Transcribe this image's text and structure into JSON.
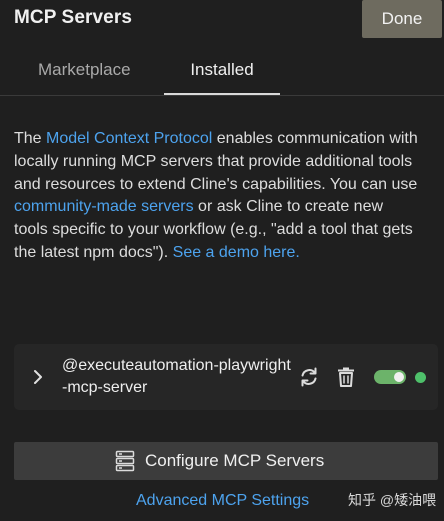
{
  "header": {
    "title": "MCP Servers",
    "done_label": "Done"
  },
  "tabs": [
    {
      "label": "Marketplace",
      "active": false
    },
    {
      "label": "Installed",
      "active": true
    }
  ],
  "description": {
    "part1": "The ",
    "link_protocol": "Model Context Protocol",
    "part2": " enables communication with locally running MCP servers that provide additional tools and resources to extend Cline's capabilities. You can use ",
    "link_community": "community-made servers",
    "part3": " or ask Cline to create new tools specific to your workflow (e.g., \"add a tool that gets the latest npm docs\"). ",
    "link_demo": "See a demo here."
  },
  "servers": [
    {
      "name": "@executeautomation-playwright-mcp-server",
      "enabled": true,
      "status_color": "#4ec06a"
    }
  ],
  "actions": {
    "configure_label": "Configure MCP Servers",
    "advanced_label": "Advanced MCP Settings"
  },
  "watermark": "知乎 @矮油喂",
  "colors": {
    "accent_link": "#4da3ee",
    "toggle_on": "#6cb36a",
    "status_ok": "#4ec06a"
  }
}
